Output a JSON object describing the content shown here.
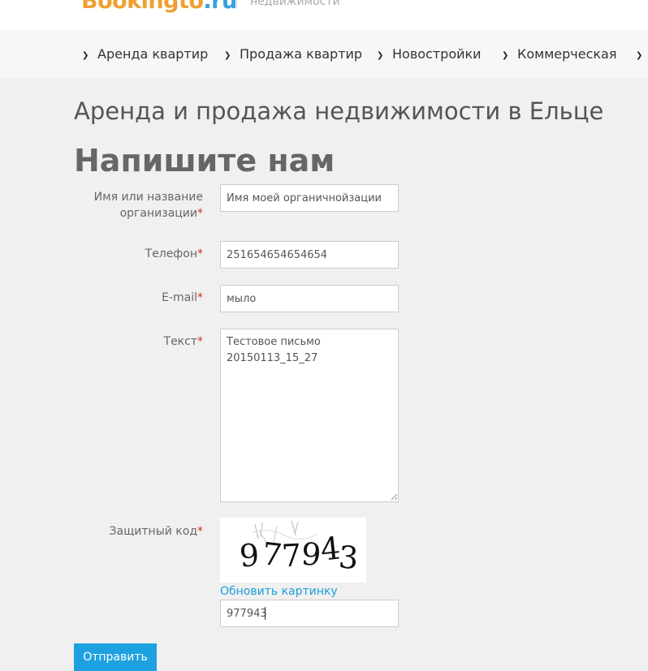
{
  "header": {
    "logo": {
      "name": "Bookingto",
      "tld": ".ru"
    },
    "tagline": "недвижимости"
  },
  "nav": {
    "items": [
      {
        "label": "Аренда квартир"
      },
      {
        "label": "Продажа квартир"
      },
      {
        "label": "Новостройки"
      },
      {
        "label": "Коммерческая"
      }
    ]
  },
  "page": {
    "region_title": "Аренда и продажа недвижимости в Ельце",
    "form_title": "Напишите нам"
  },
  "form": {
    "required_mark": "*",
    "name": {
      "label_line1": "Имя или название",
      "label_line2": "организации",
      "value": "Имя моей органичнойзации"
    },
    "phone": {
      "label": "Телефон",
      "value": "251654654654654"
    },
    "email": {
      "label": "E-mail",
      "value": "мыло"
    },
    "text": {
      "label": "Текст",
      "value": "Тестовое письмо\n20150113_15_27"
    },
    "captcha": {
      "label": "Защитный код",
      "refresh_label": "Обновить картинку",
      "value": "977943"
    },
    "submit_label": "Отправить"
  },
  "colors": {
    "accent": "#1da1e0",
    "required": "#c9302c",
    "background": "#f0f0f0"
  }
}
